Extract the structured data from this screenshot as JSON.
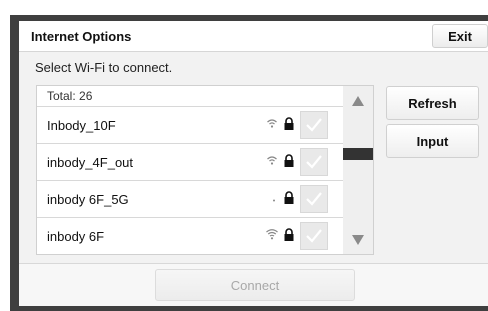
{
  "dialog": {
    "title": "Internet Options",
    "exit_label": "Exit",
    "subtitle": "Select Wi-Fi to connect."
  },
  "network_list": {
    "total_label": "Total: 26",
    "items": [
      {
        "ssid": "Inbody_10F",
        "signal_icon": "wifi-signal-icon",
        "secured": true
      },
      {
        "ssid": "inbody_4F_out",
        "signal_icon": "wifi-signal-icon",
        "secured": true
      },
      {
        "ssid": "inbody 6F_5G",
        "signal_icon": "wifi-signal-icon",
        "secured": true
      },
      {
        "ssid": "inbody 6F",
        "signal_icon": "wifi-signal-icon",
        "secured": true
      }
    ]
  },
  "buttons": {
    "refresh_label": "Refresh",
    "input_label": "Input",
    "connect_label": "Connect"
  },
  "colors": {
    "frame": "#3f3f3f",
    "dialog_bg": "#f2f2f2",
    "scroll_thumb": "#333333",
    "connect_disabled_text": "#a8a8a8"
  }
}
